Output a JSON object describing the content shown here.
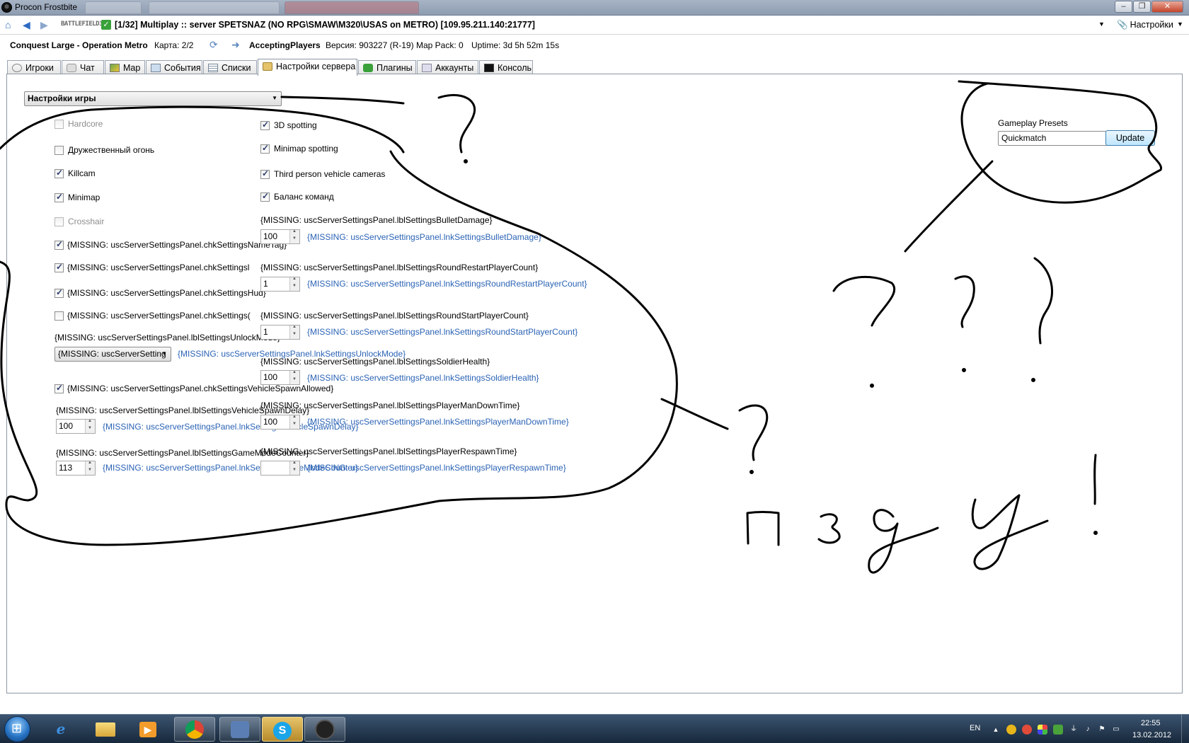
{
  "window": {
    "title": "Procon Frostbite"
  },
  "toolbar": {
    "game_logo_text": "BATTLEFIELD3",
    "server_title": "[1/32] Multiplay :: server SPETSNAZ (NO RPG\\SMAW\\M320\\USAS on METRO) [109.95.211.140:21777]",
    "settings_label": "Настройки"
  },
  "info": {
    "mode_map": "Conquest Large - Operation Metro",
    "map_count": "Карта: 2/2",
    "state": "AcceptingPlayers",
    "version": "Версия: 903227 (R-19)",
    "map_pack": "Map Pack: 0",
    "uptime": "Uptime: 3d 5h 52m 15s"
  },
  "tabs": [
    {
      "label": "Игроки",
      "active": false
    },
    {
      "label": "Чат",
      "active": false
    },
    {
      "label": "Map",
      "active": false
    },
    {
      "label": "События",
      "active": false
    },
    {
      "label": "Списки",
      "active": false
    },
    {
      "label": "Настройки сервера",
      "active": true
    },
    {
      "label": "Плагины",
      "active": false
    },
    {
      "label": "Аккаунты",
      "active": false
    },
    {
      "label": "Консоль",
      "active": false
    }
  ],
  "settings": {
    "category_select": "Настройки игры",
    "left_checkboxes": [
      {
        "label": "Hardcore",
        "checked": false,
        "disabled": true
      },
      {
        "label": "Дружественный огонь",
        "checked": false,
        "disabled": false
      },
      {
        "label": "Killcam",
        "checked": true,
        "disabled": false
      },
      {
        "label": "Minimap",
        "checked": true,
        "disabled": false
      },
      {
        "label": "Crosshair",
        "checked": false,
        "disabled": true
      },
      {
        "label": "{MISSING: uscServerSettingsPanel.chkSettingsNameTag}",
        "checked": true,
        "disabled": false
      },
      {
        "label": "{MISSING: uscServerSettingsPanel.chkSettingsl",
        "checked": true,
        "disabled": false
      },
      {
        "label": "{MISSING: uscServerSettingsPanel.chkSettingsHud}",
        "checked": true,
        "disabled": false
      },
      {
        "label": "{MISSING: uscServerSettingsPanel.chkSettings(",
        "checked": false,
        "disabled": false
      }
    ],
    "right_checkboxes": [
      {
        "label": "3D spotting",
        "checked": true
      },
      {
        "label": "Minimap spotting",
        "checked": true
      },
      {
        "label": "Third person vehicle cameras",
        "checked": true
      },
      {
        "label": "Баланс команд",
        "checked": true
      }
    ],
    "unlock_mode": {
      "label": "{MISSING: uscServerSettingsPanel.lblSettingsUnlockMode}",
      "select_value": "{MISSING: uscServerSetting",
      "link": "{MISSING: uscServerSettingsPanel.lnkSettingsUnlockMode}"
    },
    "vehicle_spawn_allowed": {
      "label": "{MISSING: uscServerSettingsPanel.chkSettingsVehicleSpawnAllowed}",
      "checked": true
    },
    "left_numeric": [
      {
        "label": "{MISSING: uscServerSettingsPanel.lblSettingsVehicleSpawnDelay}",
        "value": "100",
        "link": "{MISSING: uscServerSettingsPanel.lnkSettingsVehicleSpawnDelay}"
      },
      {
        "label": "{MISSING: uscServerSettingsPanel.lblSettingsGameModeCounter}",
        "value": "113",
        "link": "{MISSING: uscServerSettingsPanel.lnkSettingsGameModeCounter}"
      }
    ],
    "right_numeric": [
      {
        "label": "{MISSING: uscServerSettingsPanel.lblSettingsBulletDamage}",
        "value": "100",
        "link": "{MISSING: uscServerSettingsPanel.lnkSettingsBulletDamage}"
      },
      {
        "label": "{MISSING: uscServerSettingsPanel.lblSettingsRoundRestartPlayerCount}",
        "value": "1",
        "link": "{MISSING: uscServerSettingsPanel.lnkSettingsRoundRestartPlayerCount}"
      },
      {
        "label": "{MISSING: uscServerSettingsPanel.lblSettingsRoundStartPlayerCount}",
        "value": "1",
        "link": "{MISSING: uscServerSettingsPanel.lnkSettingsRoundStartPlayerCount}"
      },
      {
        "label": "{MISSING: uscServerSettingsPanel.lblSettingsSoldierHealth}",
        "value": "100",
        "link": "{MISSING: uscServerSettingsPanel.lnkSettingsSoldierHealth}"
      },
      {
        "label": "{MISSING: uscServerSettingsPanel.lblSettingsPlayerManDownTime}",
        "value": "100",
        "link": "{MISSING: uscServerSettingsPanel.lnkSettingsPlayerManDownTime}"
      },
      {
        "label": "{MISSING: uscServerSettingsPanel.lblSettingsPlayerRespawnTime}",
        "value": "",
        "link": "{MISSING: uscServerSettingsPanel.lnkSettingsPlayerRespawnTime}"
      }
    ],
    "presets": {
      "label": "Gameplay Presets",
      "value": "Quickmatch",
      "update_button": "Update"
    }
  },
  "handwriting": {
    "text": "пздц"
  },
  "taskbar": {
    "apps": [
      {
        "icon": "internet-explorer-icon",
        "running": false
      },
      {
        "icon": "explorer-folder-icon",
        "running": false
      },
      {
        "icon": "media-player-icon",
        "running": false
      },
      {
        "icon": "chrome-icon",
        "running": true
      },
      {
        "icon": "app-icon",
        "running": true
      },
      {
        "icon": "skype-icon",
        "running": true,
        "active": true
      },
      {
        "icon": "procon-icon",
        "running": true
      }
    ],
    "language": "EN",
    "time": "22:55",
    "date": "13.02.2012"
  }
}
